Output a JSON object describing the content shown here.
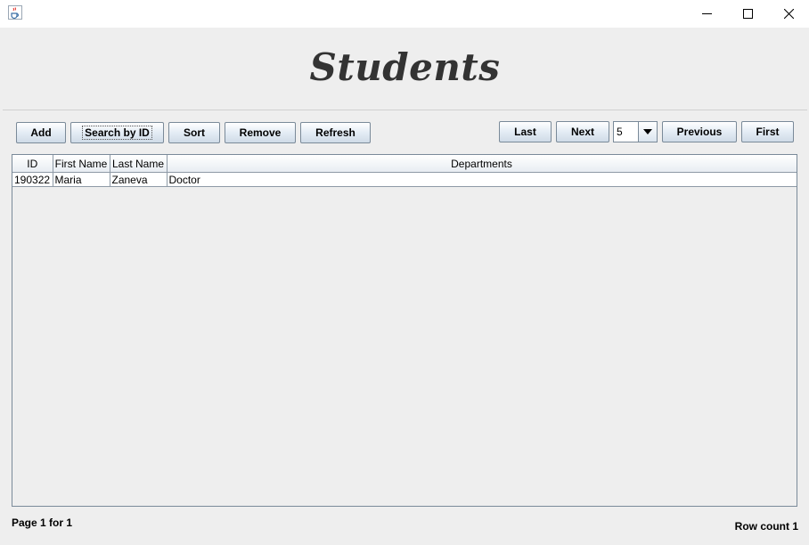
{
  "window": {
    "icon": "java-cup-icon",
    "controls": [
      "minimize-icon",
      "maximize-icon",
      "close-icon"
    ]
  },
  "header": {
    "title": "Students"
  },
  "toolbar": {
    "add_label": "Add",
    "search_label": "Search by ID",
    "sort_label": "Sort",
    "remove_label": "Remove",
    "refresh_label": "Refresh"
  },
  "pagination": {
    "last_label": "Last",
    "next_label": "Next",
    "page_size": "5",
    "previous_label": "Previous",
    "first_label": "First"
  },
  "table": {
    "columns": [
      "ID",
      "First Name",
      "Last Name",
      "Departments"
    ],
    "rows": [
      [
        "190322",
        "Maria",
        "Zaneva",
        "Doctor"
      ]
    ]
  },
  "footer": {
    "page_info": "Page 1 for 1",
    "row_count": "Row count 1"
  },
  "colors": {
    "background": "#eeeeee",
    "title_text": "#333333",
    "border": "#7a8a99"
  }
}
